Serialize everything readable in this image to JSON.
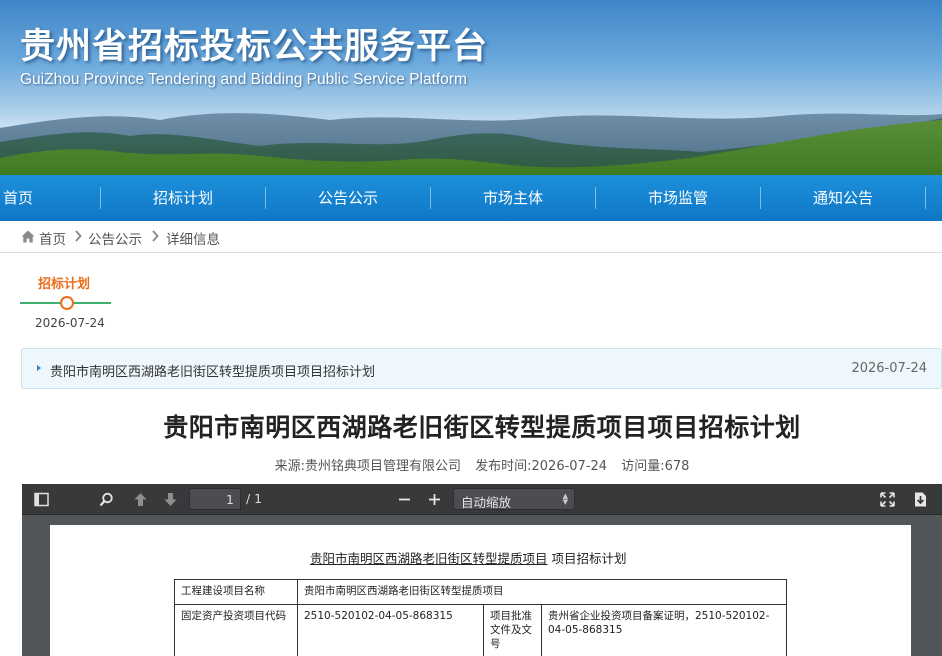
{
  "banner": {
    "title": "贵州省招标投标公共服务平台",
    "subtitle": "GuiZhou Province Tendering and Bidding Public Service Platform"
  },
  "nav": {
    "items": [
      "首页",
      "招标计划",
      "公告公示",
      "市场主体",
      "市场监管",
      "通知公告"
    ]
  },
  "breadcrumb": {
    "items": [
      "首页",
      "公告公示",
      "详细信息"
    ]
  },
  "timeline": {
    "label": "招标计划",
    "date": "2026-07-24"
  },
  "notice": {
    "title": "贵阳市南明区西湖路老旧街区转型提质项目项目招标计划",
    "date": "2026-07-24"
  },
  "article": {
    "title": "贵阳市南明区西湖路老旧街区转型提质项目项目招标计划",
    "source": "来源:贵州铭典项目管理有限公司",
    "publish_time": "发布时间:2026-07-24",
    "views": "访问量:678"
  },
  "pdf_viewer": {
    "page_current": "1",
    "page_total": "/ 1",
    "zoom": "自动缩放",
    "icons": [
      "sidebar-toggle-icon",
      "search-icon",
      "arrow-up-icon",
      "arrow-down-icon",
      "zoom-out-icon",
      "zoom-in-icon",
      "fullscreen-icon",
      "download-icon"
    ],
    "doc_title_part1": "贵阳市南明区西湖路老旧街区转型提质项目",
    "doc_title_part2": " 项目招标计划",
    "table": {
      "row1_label": "工程建设项目名称",
      "row1_value": "贵阳市南明区西湖路老旧街区转型提质项目",
      "row2_label": "固定资产投资项目代码",
      "row2_value": "2510-520102-04-05-868315",
      "row2_label2": "项目批准文件及文号",
      "row2_value2": "贵州省企业投资项目备案证明，2510-520102-04-05-868315"
    }
  },
  "colors": {
    "nav_bg": "#1484d2",
    "accent_orange": "#ec6d1a",
    "timeline_green": "#3fb06e",
    "pdf_toolbar": "#38393b"
  }
}
